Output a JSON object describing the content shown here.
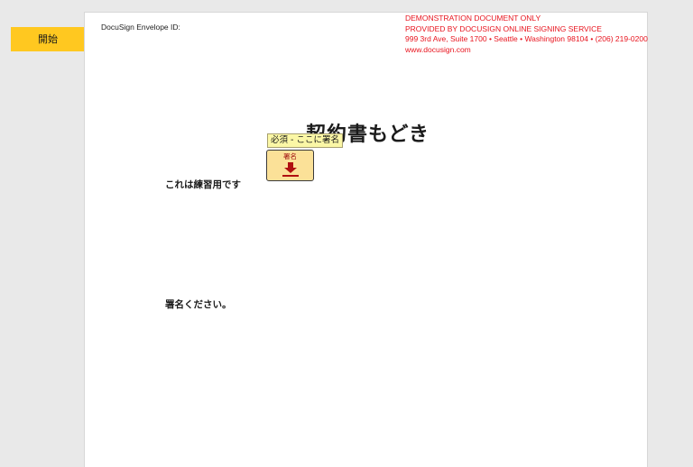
{
  "toolbar": {
    "start_label": "開始"
  },
  "document": {
    "envelope_id_label": "DocuSign Envelope ID:",
    "demo_notice": {
      "line1": "DEMONSTRATION DOCUMENT ONLY",
      "line2": "PROVIDED BY DOCUSIGN ONLINE SIGNING SERVICE",
      "line3": "999 3rd Ave, Suite 1700  • Seattle • Washington 98104 • (206) 219-0200",
      "line4": "www.docusign.com",
      "color": "#e8141e"
    },
    "title": "契約書もどき",
    "body_line_1": "これは練習用です",
    "body_line_2": "署名ください。"
  },
  "sign_tab": {
    "tooltip": "必須 - ここに署名",
    "label": "署名",
    "icon": "download-arrow-icon",
    "fill_color": "#fbe198",
    "tooltip_color": "#fbf7a6"
  },
  "colors": {
    "start_button": "#ffc820",
    "background": "#e9e9e9"
  }
}
